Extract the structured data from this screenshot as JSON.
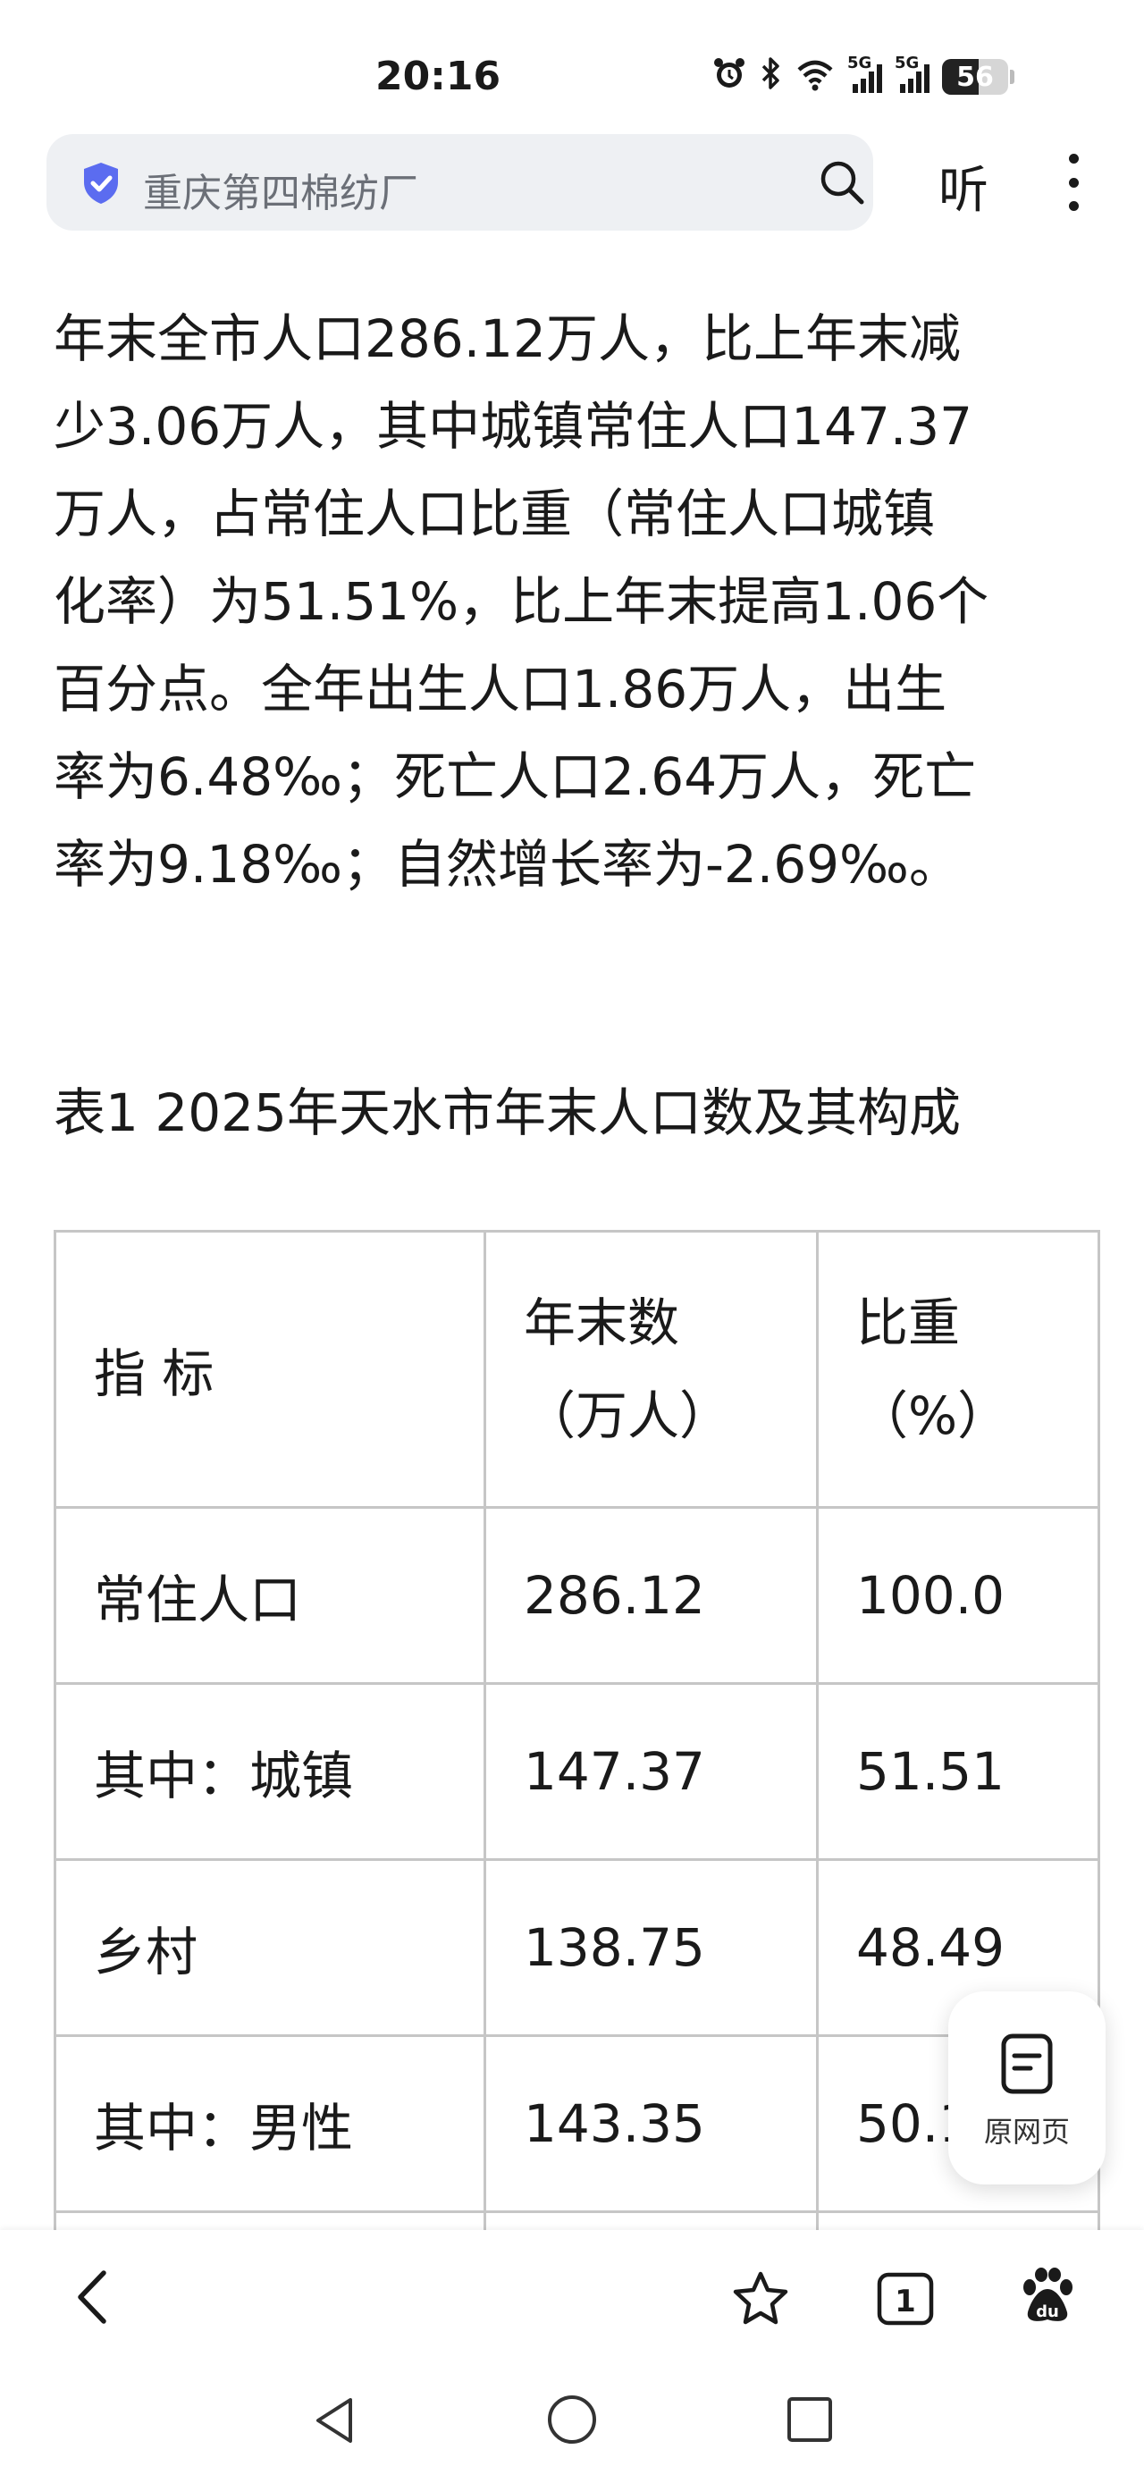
{
  "status_bar": {
    "time": "20:16",
    "signal1_tag": "5G",
    "signal2_tag": "5G",
    "battery_level": "56",
    "battery_fraction": 0.56
  },
  "search": {
    "query": "重庆第四棉纺厂"
  },
  "header": {
    "listen_label": "听"
  },
  "article": {
    "lines": [
      "年末全市人口286.12万人，比上年末减",
      "少3.06万人，其中城镇常住人口147.37",
      "万人，占常住人口比重（常住人口城镇",
      "化率）为51.51%，比上年末提高1.06个",
      "百分点。全年出生人口1.86万人，出生",
      "率为6.48‰；死亡人口2.64万人，死亡",
      "率为9.18‰；自然增长率为-2.69‰。"
    ],
    "table_title": "表1 2025年天水市年末人口数及其构成"
  },
  "table": {
    "header": {
      "indicator": "指 标",
      "count_line1": "年末数",
      "count_line2": "（万人）",
      "share_line1": "比重",
      "share_line2": "（%）"
    },
    "rows": [
      {
        "name": "常住人口",
        "count": "286.12",
        "share": "100.0"
      },
      {
        "name": "其中：城镇",
        "count": "147.37",
        "share": "51.51"
      },
      {
        "name": "乡村",
        "count": "138.75",
        "share": "48.49"
      },
      {
        "name": "其中：男性",
        "count": "143.35",
        "share": "50.1"
      }
    ]
  },
  "floating_button": {
    "label": "原网页"
  },
  "bottom_toolbar": {
    "tab_count": "1"
  },
  "icons": {
    "alarm": "alarm-clock-icon",
    "bluetooth": "bluetooth-icon",
    "wifi": "wifi-icon",
    "shield": "security-shield-icon",
    "search": "search-icon",
    "more": "more-vertical-icon",
    "back": "chevron-left-icon",
    "favorite": "star-icon",
    "tabs": "tabs-icon",
    "baidu": "baidu-paw-icon",
    "document": "document-icon"
  },
  "colors": {
    "shield": "#5B6CF0",
    "search_bg": "#eef0f3",
    "table_border": "#c6c6c6"
  }
}
